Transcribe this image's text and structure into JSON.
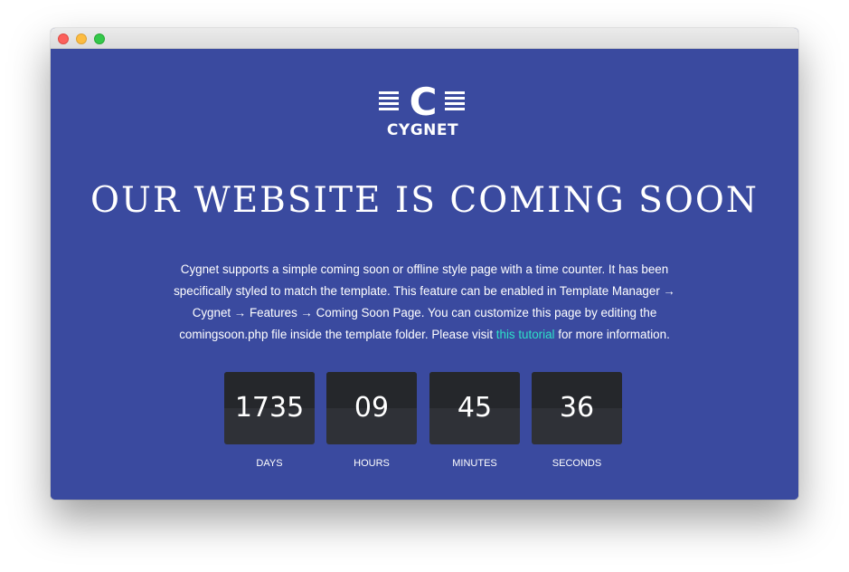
{
  "window": {
    "controls": [
      "close",
      "minimize",
      "maximize"
    ]
  },
  "logo": {
    "letter": "C",
    "name": "CYGNET"
  },
  "headline": "OUR WEBSITE IS COMING SOON",
  "description": {
    "text_before_link": "Cygnet supports a simple coming soon or offline style page with a time counter. It has been specifically styled to match the template. This feature can be enabled in Template Manager → Cygnet → Features → Coming Soon Page. You can customize this page by editing the comingsoon.php file inside the template folder. Please visit ",
    "link_text": "this tutorial",
    "text_after_link": " for more information."
  },
  "countdown": [
    {
      "value": "1735",
      "label": "DAYS"
    },
    {
      "value": "09",
      "label": "HOURS"
    },
    {
      "value": "45",
      "label": "MINUTES"
    },
    {
      "value": "36",
      "label": "SECONDS"
    }
  ],
  "colors": {
    "background": "#3a4a9f",
    "link": "#2de0c8",
    "counter_box": "#2f3137",
    "counter_box_top": "#25272b",
    "text": "#ffffff"
  }
}
